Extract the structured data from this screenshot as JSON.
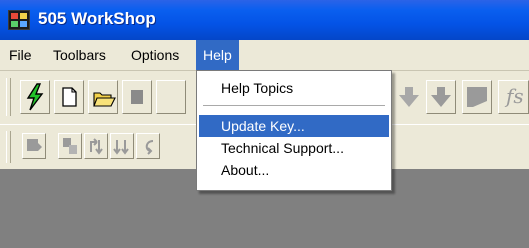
{
  "window": {
    "title": "505 WorkShop"
  },
  "menubar": {
    "items": [
      {
        "label": "File"
      },
      {
        "label": "Toolbars"
      },
      {
        "label": "Options"
      },
      {
        "label": "Help"
      }
    ]
  },
  "help_menu": {
    "items": [
      {
        "label": "Help Topics"
      },
      {
        "label": "Update Key..."
      },
      {
        "label": "Technical Support..."
      },
      {
        "label": "About..."
      }
    ],
    "highlighted": "Update Key..."
  },
  "toolbar": {
    "right_glyph": "fs"
  },
  "colors": {
    "titlebar": "#0453e6",
    "highlight": "#316ac5",
    "menubar": "#ece9d8",
    "workspace": "#808080"
  }
}
